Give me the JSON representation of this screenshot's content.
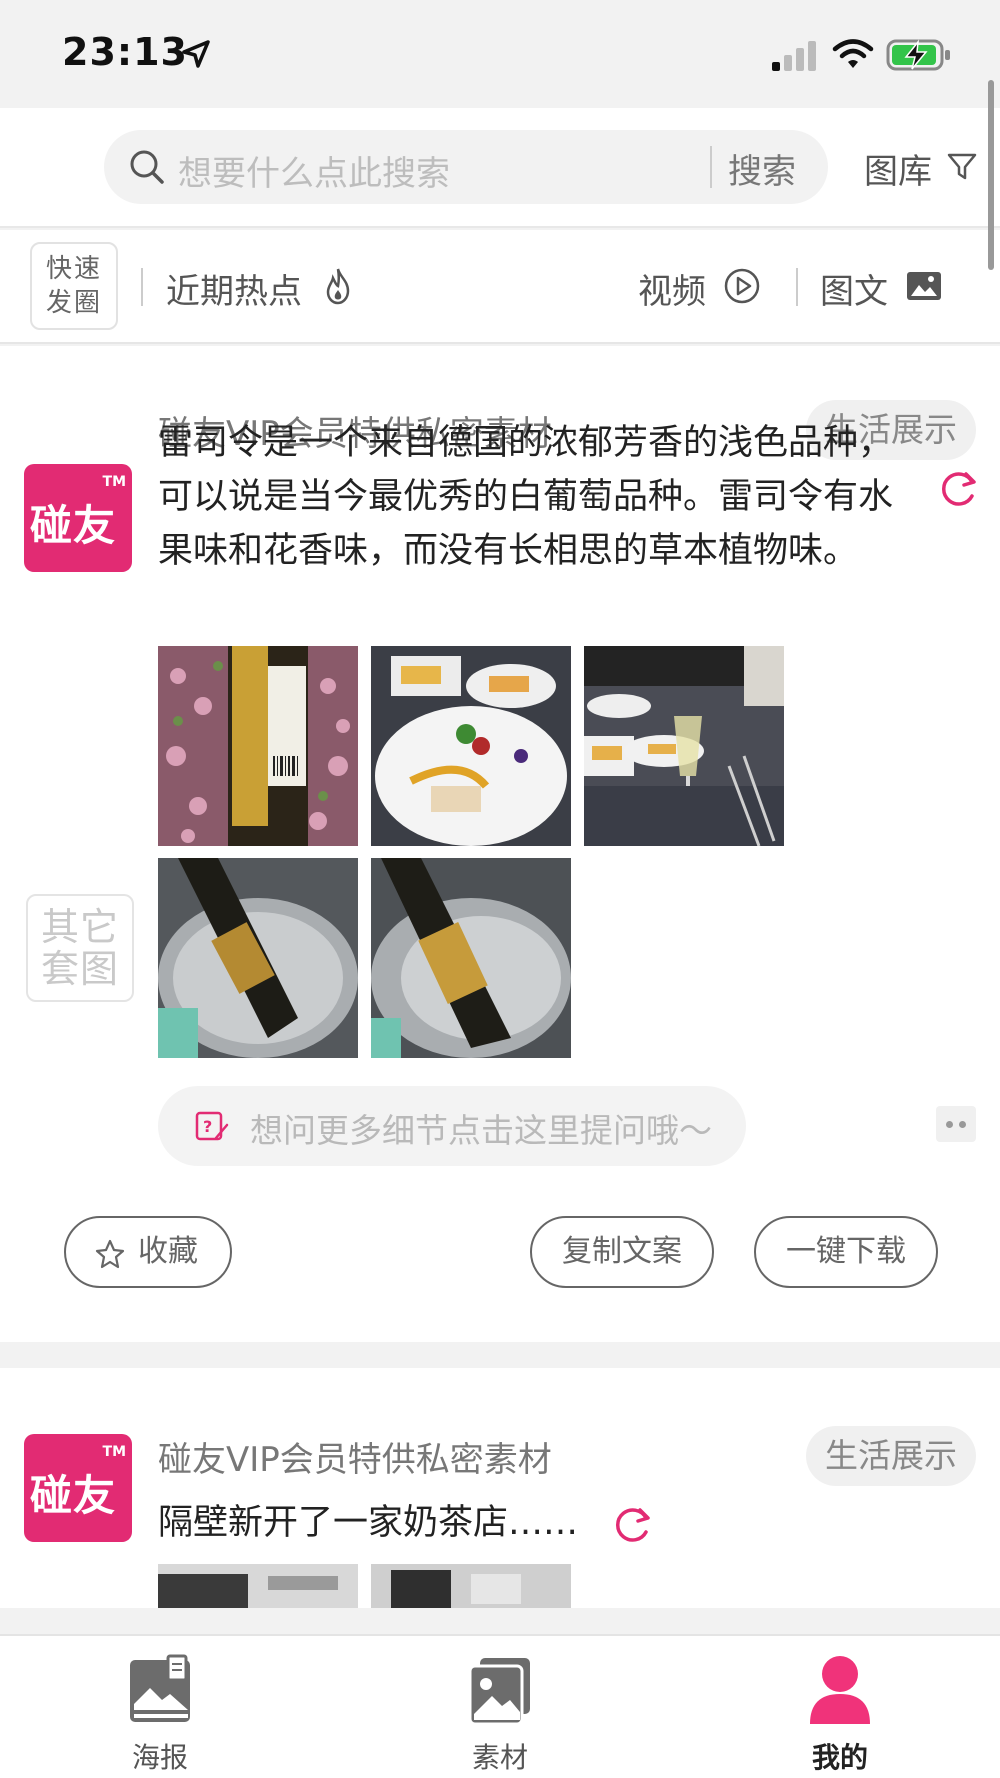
{
  "status_bar": {
    "time": "23:13"
  },
  "search": {
    "placeholder": "想要什么点此搜索",
    "button_label": "搜索",
    "gallery_label": "图库"
  },
  "categories": {
    "quick_post_line1": "快速",
    "quick_post_line2": "发圈",
    "hot_label": "近期热点",
    "video_label": "视频",
    "image_text_label": "图文"
  },
  "posts": [
    {
      "author": "碰友VIP会员特供私密素材",
      "tag": "生活展示",
      "avatar_text": "碰友",
      "avatar_tm": "TM",
      "text_line1": "雷司令是一个来自德国的浓郁芳香的浅色品种，",
      "text_line2": "可以说是当今最优秀的白葡萄品种。雷司令有水",
      "text_line3": "果味和花香味，而没有长相思的草本植物味。",
      "other_sets_line1": "其它",
      "other_sets_line2": "套图",
      "ask_placeholder": "想问更多细节点击这里提问哦～",
      "favorite_label": "收藏",
      "copy_label": "复制文案",
      "download_label": "一键下载",
      "image_count": 5
    },
    {
      "author": "碰友VIP会员特供私密素材",
      "tag": "生活展示",
      "avatar_text": "碰友",
      "avatar_tm": "TM",
      "text_line1": "隔壁新开了一家奶茶店……",
      "image_count": 2
    }
  ],
  "bottom_nav": [
    {
      "label": "海报",
      "icon": "poster-icon",
      "active": false
    },
    {
      "label": "素材",
      "icon": "material-icon",
      "active": false
    },
    {
      "label": "我的",
      "icon": "profile-icon",
      "active": true
    }
  ],
  "colors": {
    "brand": "#e22b73",
    "active_nav": "#f0337a",
    "inactive_icon": "#6c6c6c"
  }
}
